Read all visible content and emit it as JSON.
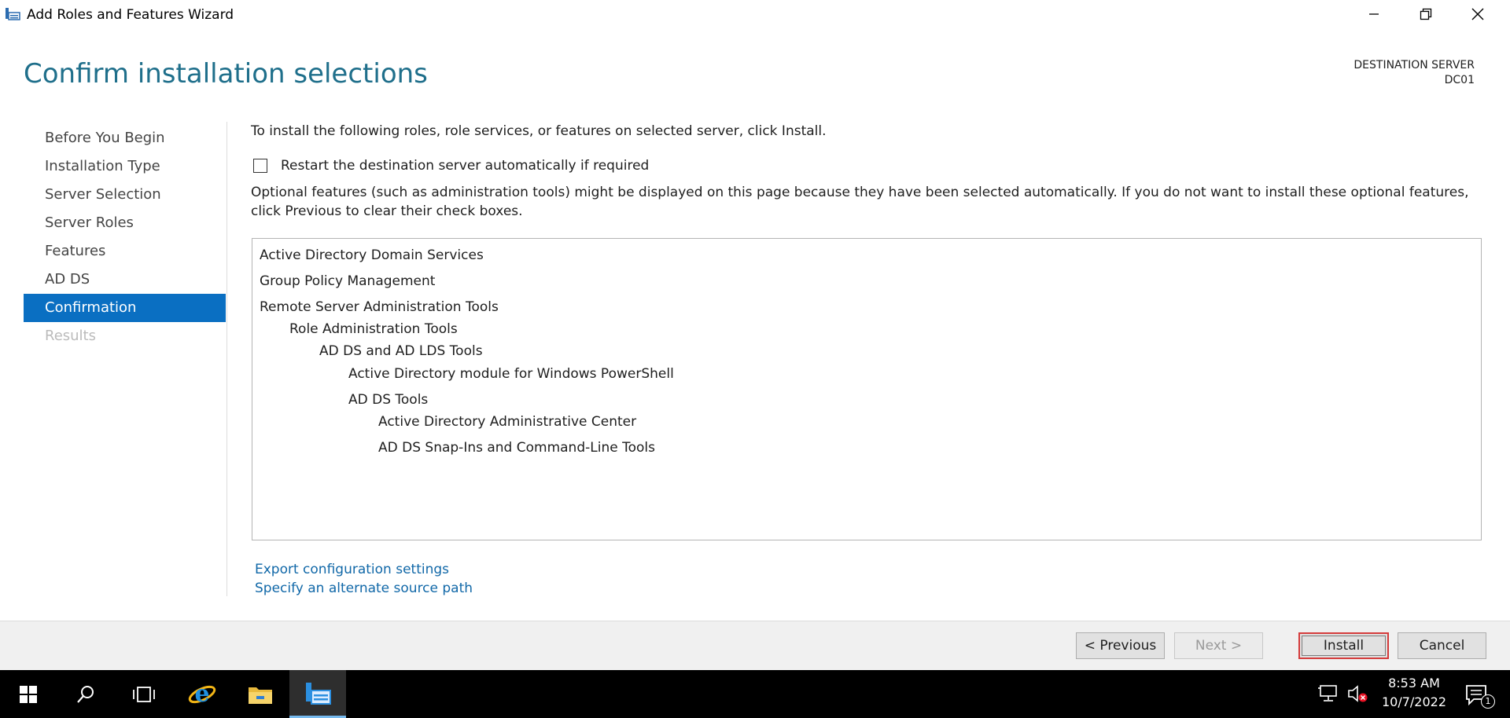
{
  "window": {
    "title": "Add Roles and Features Wizard",
    "controls": {
      "minimize": "minimize",
      "restore": "restore",
      "close": "close"
    }
  },
  "header": {
    "page_title": "Confirm installation selections",
    "destination_label": "DESTINATION SERVER",
    "destination_server": "DC01"
  },
  "nav": {
    "items": [
      {
        "label": "Before You Begin",
        "state": "normal"
      },
      {
        "label": "Installation Type",
        "state": "normal"
      },
      {
        "label": "Server Selection",
        "state": "normal"
      },
      {
        "label": "Server Roles",
        "state": "normal"
      },
      {
        "label": "Features",
        "state": "normal"
      },
      {
        "label": "AD DS",
        "state": "normal"
      },
      {
        "label": "Confirmation",
        "state": "active"
      },
      {
        "label": "Results",
        "state": "disabled"
      }
    ]
  },
  "main": {
    "instruction": "To install the following roles, role services, or features on selected server, click Install.",
    "restart_checkbox": {
      "label": "Restart the destination server automatically if required",
      "checked": false
    },
    "optional_note": "Optional features (such as administration tools) might be displayed on this page because they have been selected automatically. If you do not want to install these optional features, click Previous to clear their check boxes.",
    "selections": [
      {
        "label": "Active Directory Domain Services",
        "level": 0
      },
      {
        "label": "Group Policy Management",
        "level": 0
      },
      {
        "label": "Remote Server Administration Tools",
        "level": 0
      },
      {
        "label": "Role Administration Tools",
        "level": 1
      },
      {
        "label": "AD DS and AD LDS Tools",
        "level": 2
      },
      {
        "label": "Active Directory module for Windows PowerShell",
        "level": 3
      },
      {
        "label": "AD DS Tools",
        "level": 3
      },
      {
        "label": "Active Directory Administrative Center",
        "level": 4
      },
      {
        "label": "AD DS Snap-Ins and Command-Line Tools",
        "level": 4
      }
    ],
    "links": {
      "export": "Export configuration settings",
      "alternate_source": "Specify an alternate source path"
    }
  },
  "footer": {
    "previous": "< Previous",
    "next": "Next >",
    "install": "Install",
    "cancel": "Cancel"
  },
  "taskbar": {
    "icons": [
      "windows-start-icon",
      "search-icon",
      "task-view-icon",
      "internet-explorer-icon",
      "file-explorer-icon",
      "server-manager-wizard-icon"
    ],
    "clock_time": "8:53 AM",
    "clock_date": "10/7/2022",
    "notification_count": "1"
  },
  "colors": {
    "title_accent": "#1f6f8b",
    "nav_active_bg": "#0a6fc2",
    "link": "#1168a8",
    "install_highlight": "#d43b3b"
  }
}
